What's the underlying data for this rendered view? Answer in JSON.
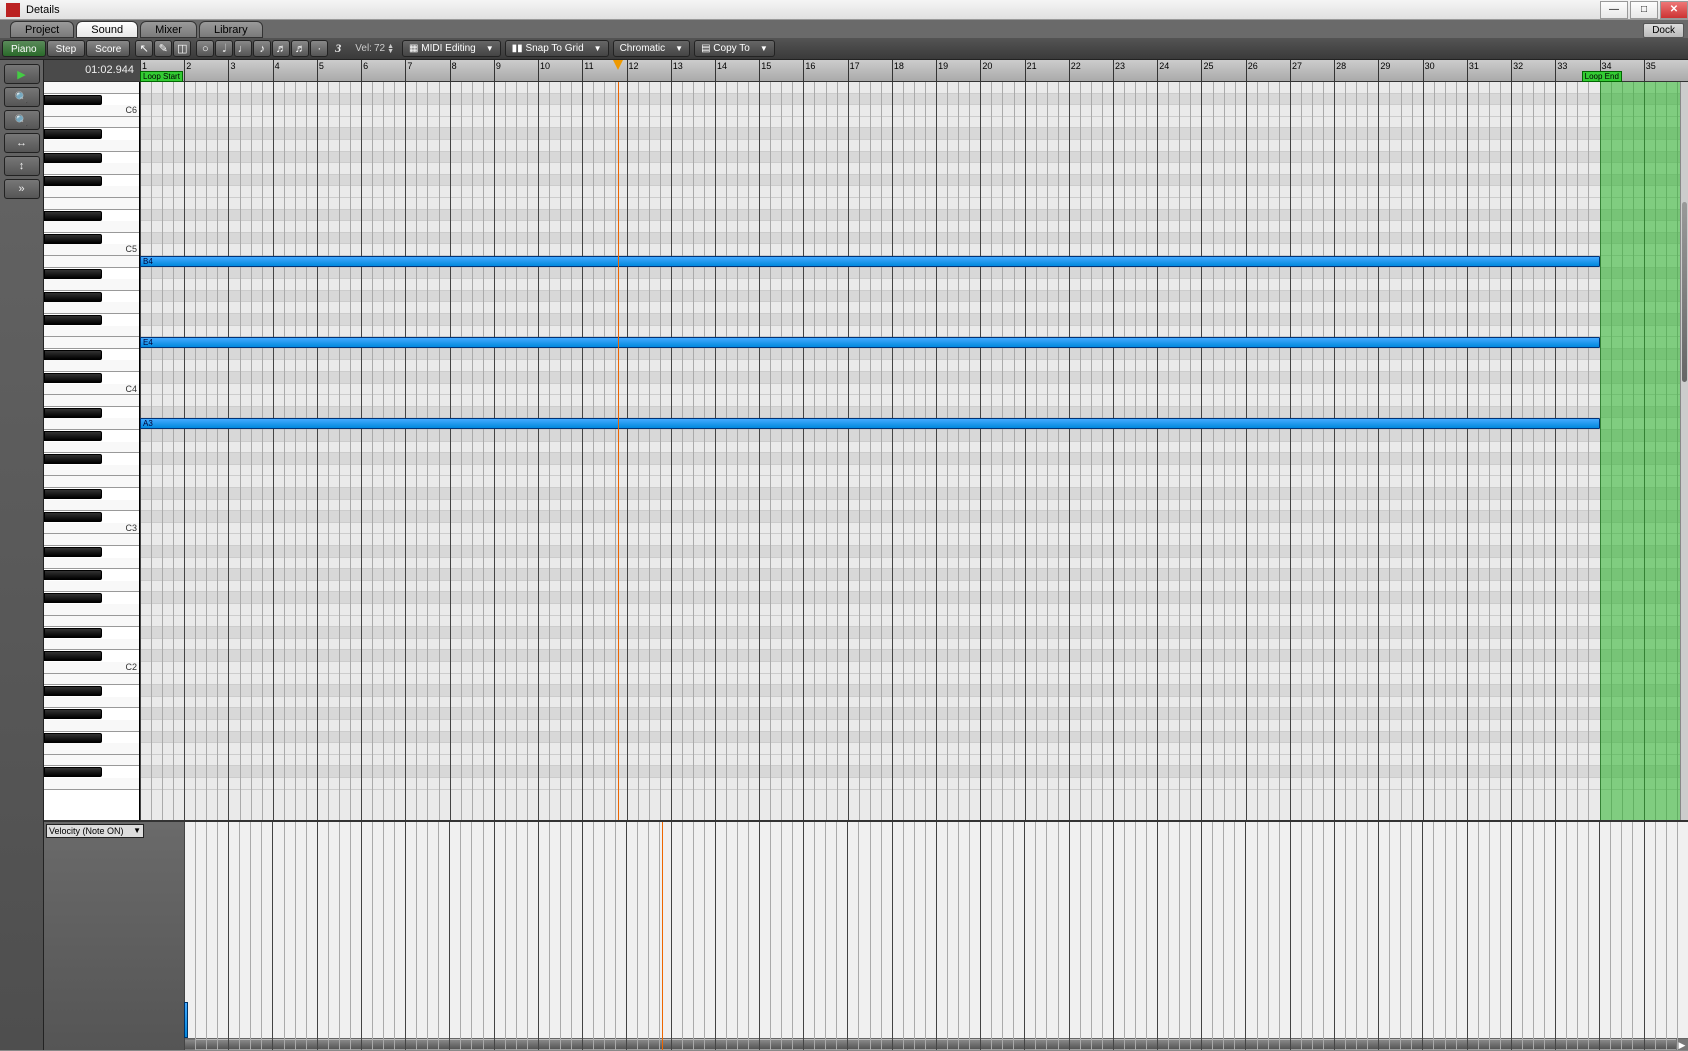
{
  "title": "Details",
  "win_tabs": [
    "Project",
    "Sound",
    "Mixer",
    "Library"
  ],
  "active_win_tab": 1,
  "dock_label": "Dock",
  "toolbar": {
    "view_tabs": [
      "Piano",
      "Step",
      "Score"
    ],
    "active_view_tab": 0,
    "velocity_label": "Vel:",
    "velocity_value": "72",
    "triplet_value": "3",
    "mode_dd": "MIDI Editing",
    "snap_dd": "Snap To Grid",
    "scale_dd": "Chromatic",
    "copy_dd": "Copy To"
  },
  "timecode": "01:02.944",
  "loop_start_label": "Loop Start",
  "loop_end_label": "Loop End",
  "measures": [
    "1",
    "2",
    "3",
    "4",
    "5",
    "6",
    "7",
    "8",
    "9",
    "10",
    "11",
    "12",
    "13",
    "14",
    "15",
    "16",
    "17",
    "18",
    "19",
    "20",
    "21",
    "22",
    "23",
    "24",
    "25",
    "26",
    "27",
    "28",
    "29",
    "30",
    "31",
    "32",
    "33",
    "34",
    "35"
  ],
  "playhead_measure": 11.8,
  "loop_start_measure": 1,
  "loop_end_measure": 34.5,
  "green_start_measure": 34,
  "key_labels": {
    "C6": "C6",
    "C5": "C5",
    "C4": "C4",
    "C3": "C3"
  },
  "notes": [
    {
      "pitch": "B4",
      "label": "B4",
      "start": 1,
      "len": 33
    },
    {
      "pitch": "E4",
      "label": "E4",
      "start": 1,
      "len": 33
    },
    {
      "pitch": "A3",
      "label": "A3",
      "start": 1,
      "len": 33
    }
  ],
  "lower_dd": "Velocity (Note ON)",
  "velocity_bars": [
    {
      "x": 1,
      "h": 0.18
    }
  ]
}
